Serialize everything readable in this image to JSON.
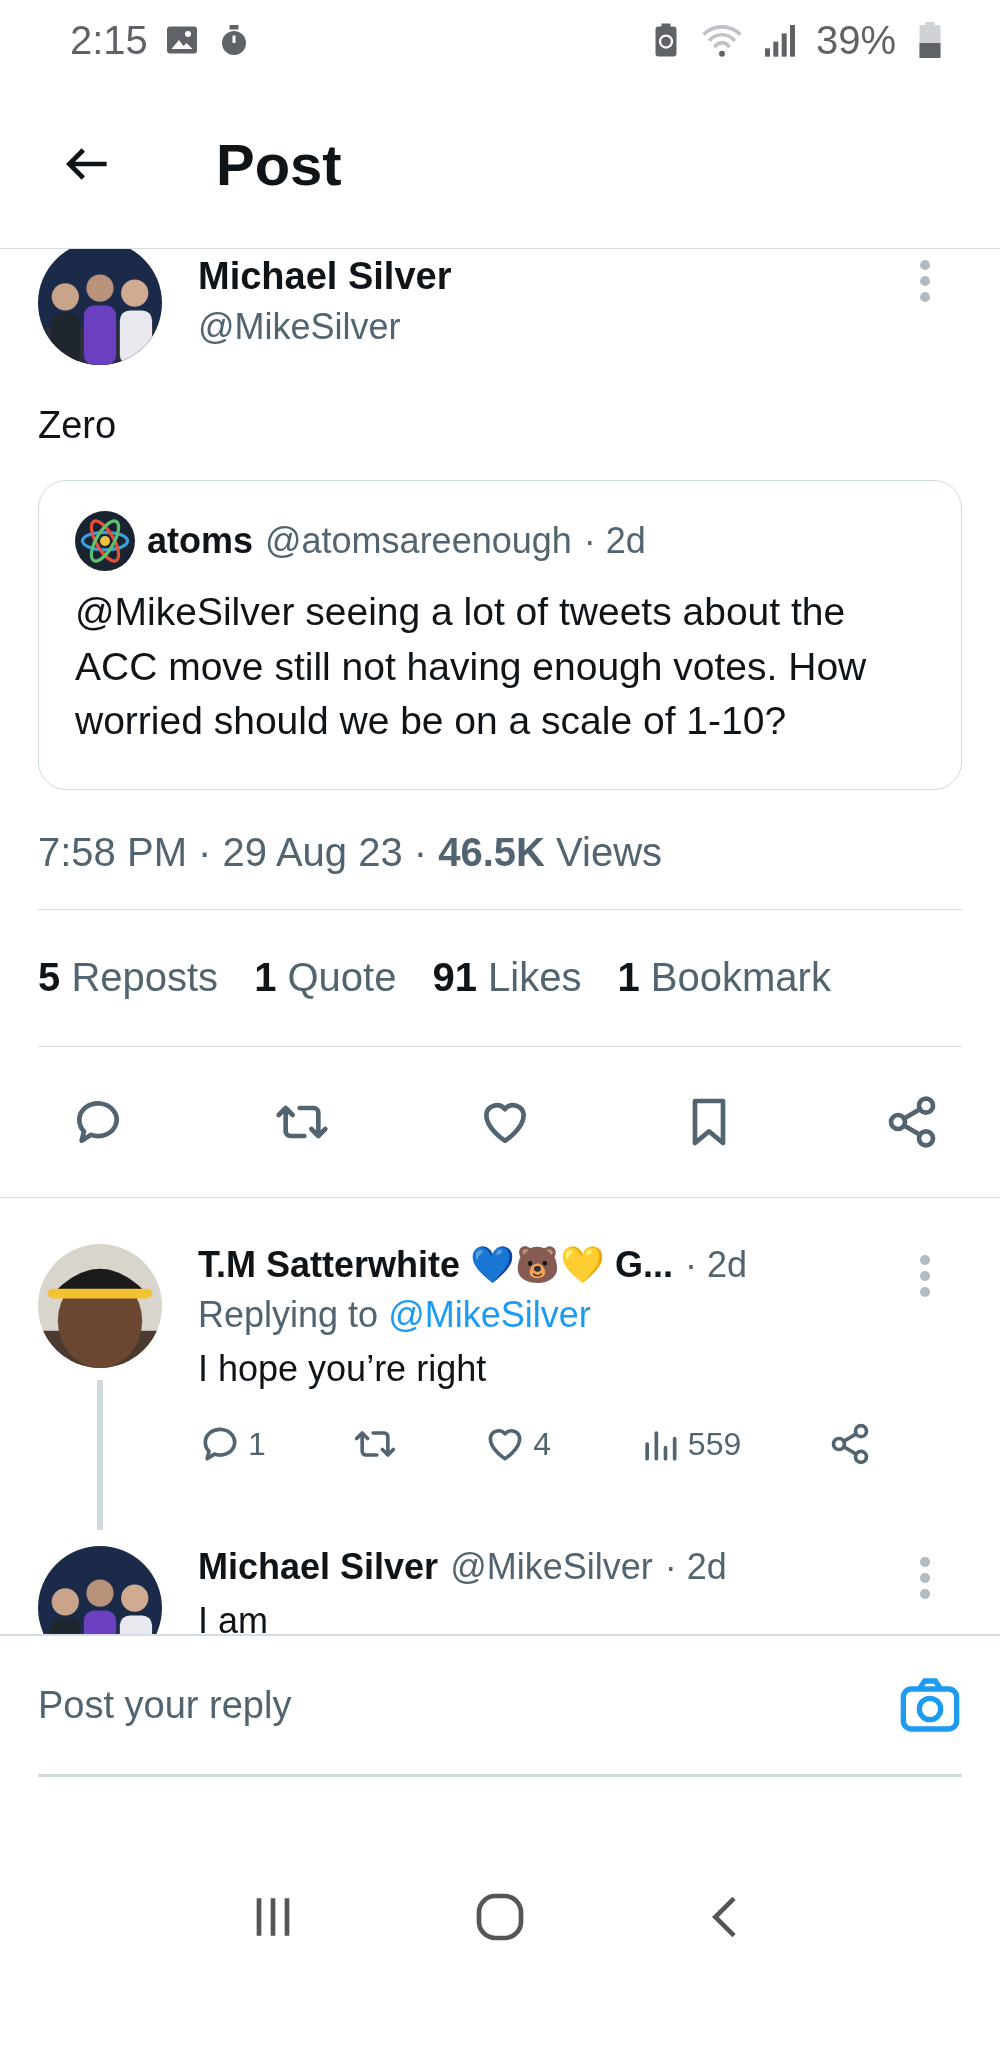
{
  "status_bar": {
    "time": "2:15",
    "battery": "39%"
  },
  "header": {
    "title": "Post"
  },
  "post": {
    "name": "Michael Silver",
    "handle": "@MikeSilver",
    "text": "Zero",
    "quote": {
      "name": "atoms",
      "handle": "@atomsareenough",
      "age": "· 2d",
      "text": "@MikeSilver seeing a lot of tweets about the ACC move still not having enough votes. How worried should we be on a scale of 1-10?"
    },
    "meta": "7:58 PM · 29 Aug 23 · **46.5K** Views",
    "stats": [
      {
        "count": "5",
        "label": "Reposts"
      },
      {
        "count": "1",
        "label": "Quote"
      },
      {
        "count": "91",
        "label": "Likes"
      },
      {
        "count": "1",
        "label": "Bookmark"
      }
    ]
  },
  "replies": [
    {
      "kind": "reply",
      "name": "T.M Satterwhite 💙🐻💛 G...",
      "age": "· 2d",
      "replying_label": "Replying to",
      "replying_to": "@MikeSilver",
      "text": "I hope you’re right",
      "counts": {
        "reply": "1",
        "like": "4",
        "views": "559"
      },
      "thread": true
    },
    {
      "kind": "reply",
      "name": "Michael Silver",
      "handle": "@MikeSilver",
      "age": "· 2d",
      "text": "I am",
      "thread": false
    }
  ],
  "composer": {
    "placeholder": "Post your reply"
  }
}
